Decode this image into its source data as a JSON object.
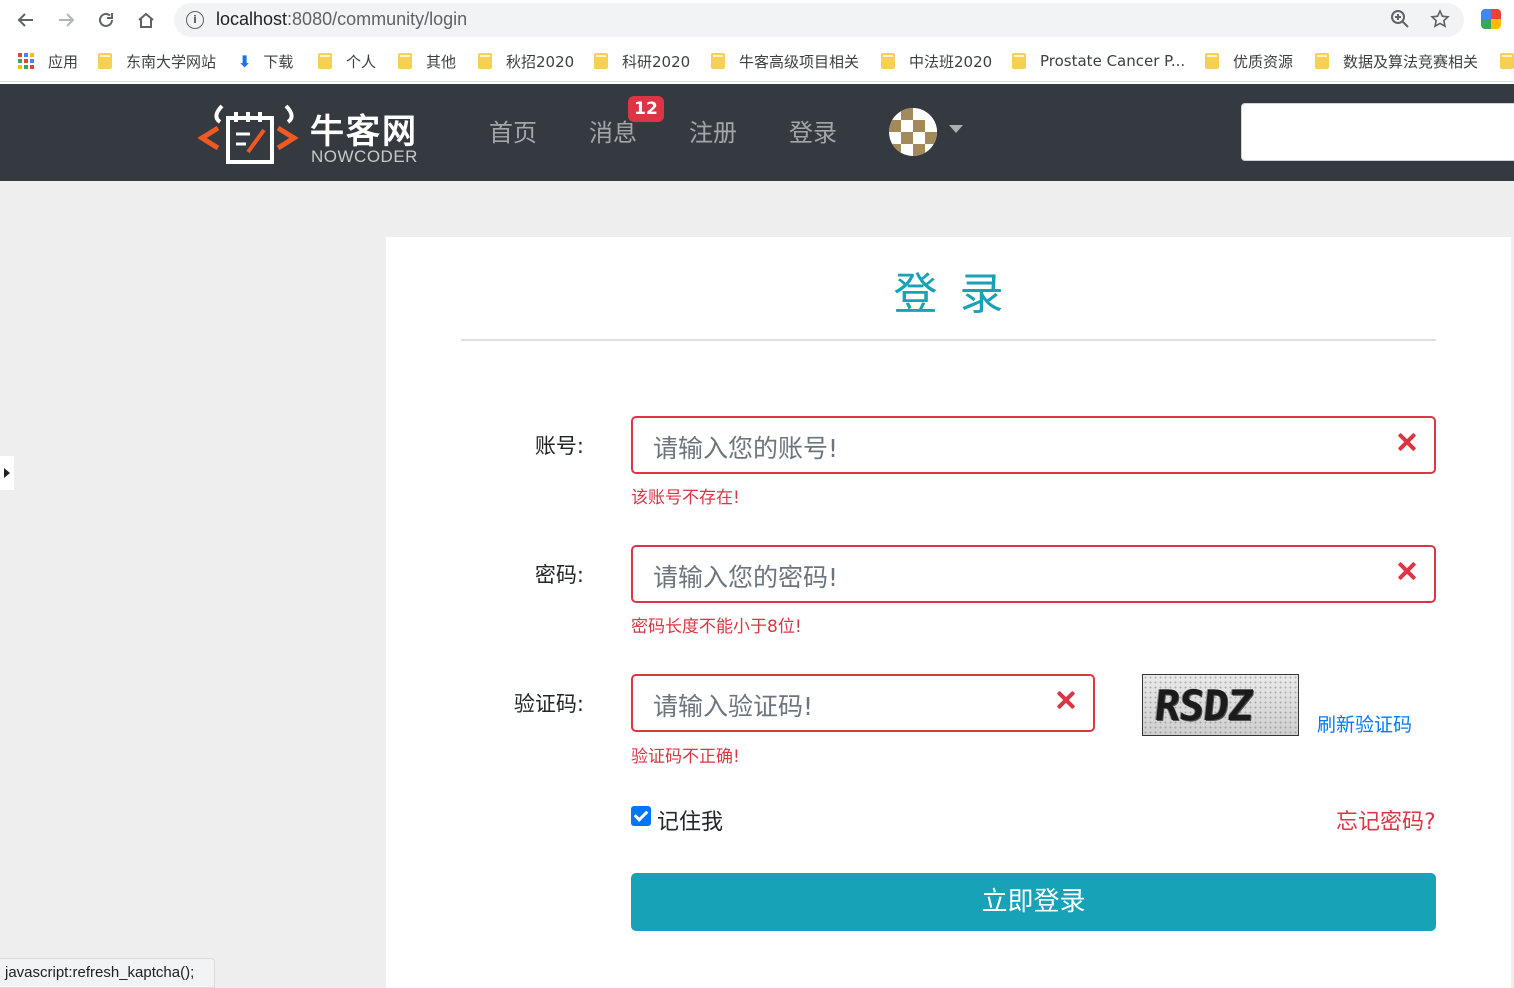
{
  "browser": {
    "url_host": "localhost",
    "url_path": ":8080/community/login",
    "bookmarks": [
      {
        "label": "应用",
        "type": "apps"
      },
      {
        "label": "东南大学网站",
        "type": "folder"
      },
      {
        "label": "下载",
        "type": "download"
      },
      {
        "label": "个人",
        "type": "folder"
      },
      {
        "label": "其他",
        "type": "folder"
      },
      {
        "label": "秋招2020",
        "type": "folder"
      },
      {
        "label": "科研2020",
        "type": "folder"
      },
      {
        "label": "牛客高级项目相关",
        "type": "folder"
      },
      {
        "label": "中法班2020",
        "type": "folder"
      },
      {
        "label": "Prostate Cancer P...",
        "type": "folder"
      },
      {
        "label": "优质资源",
        "type": "folder"
      },
      {
        "label": "数据及算法竞赛相关",
        "type": "folder"
      }
    ],
    "status_text": "javascript:refresh_kaptcha();"
  },
  "header": {
    "logo_cn": "牛客网",
    "logo_en": "NOWCODER",
    "nav": {
      "home": "首页",
      "messages": "消息",
      "register": "注册",
      "login": "登录"
    },
    "message_badge": "12"
  },
  "login": {
    "title": "登录",
    "account_label": "账号:",
    "account_placeholder": "请输入您的账号!",
    "account_error": "该账号不存在!",
    "password_label": "密码:",
    "password_placeholder": "请输入您的密码!",
    "password_error": "密码长度不能小于8位!",
    "captcha_label": "验证码:",
    "captcha_placeholder": "请输入验证码!",
    "captcha_error": "验证码不正确!",
    "captcha_image_text": "RSDZ",
    "refresh_captcha": "刷新验证码",
    "remember_me": "记住我",
    "remember_checked": true,
    "forgot_password": "忘记密码?",
    "submit": "立即登录"
  },
  "colors": {
    "primary": "#17a2b8",
    "danger": "#dc3545",
    "header_bg": "#343a40",
    "link": "#007bff"
  }
}
